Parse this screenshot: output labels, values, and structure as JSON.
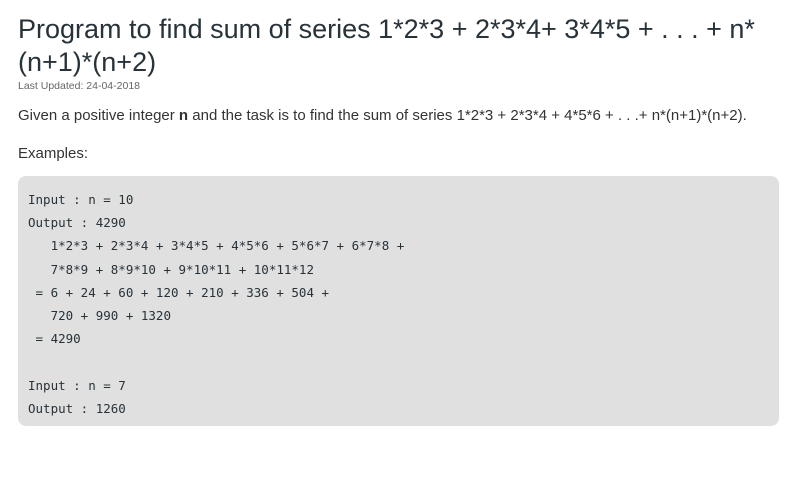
{
  "article": {
    "title": "Program to find sum of series 1*2*3 + 2*3*4+ 3*4*5 + . . . + n*(n+1)*(n+2)",
    "last_updated": "Last Updated: 24-04-2018",
    "description_before": "Given a positive integer ",
    "description_bold": "n",
    "description_after": " and the task is to find the sum of series 1*2*3 + 2*3*4 + 4*5*6 + . . .+ n*(n+1)*(n+2).",
    "examples_label": "Examples:",
    "code": "Input : n = 10\nOutput : 4290\n   1*2*3 + 2*3*4 + 3*4*5 + 4*5*6 + 5*6*7 + 6*7*8 +\n   7*8*9 + 8*9*10 + 9*10*11 + 10*11*12\n = 6 + 24 + 60 + 120 + 210 + 336 + 504 +\n   720 + 990 + 1320\n = 4290\n\nInput : n = 7\nOutput : 1260"
  }
}
